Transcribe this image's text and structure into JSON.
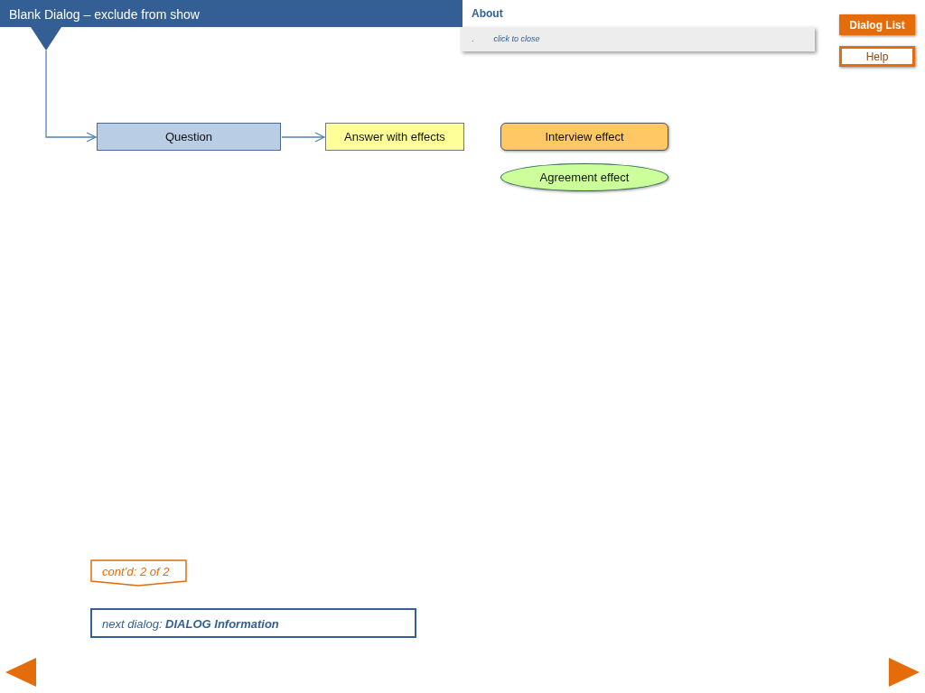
{
  "header": {
    "title": "Blank Dialog – exclude from show"
  },
  "about": {
    "title": "About",
    "bullet": ".",
    "hint": "click to close"
  },
  "buttons": [
    {
      "label": "Dialog List",
      "kind": "filled"
    },
    {
      "label": "Help",
      "kind": "outline"
    }
  ],
  "flow": {
    "nodes": [
      {
        "label": "Question",
        "kind": "question"
      },
      {
        "label": "Answer with effects",
        "kind": "answer"
      }
    ],
    "effects": [
      {
        "label": "Interview effect",
        "kind": "interview"
      },
      {
        "label": "Agreement effect",
        "kind": "agreement"
      }
    ]
  },
  "continued": "cont’d: 2 of 2",
  "next_dialog": "next dialog: **DIALOG Information**"
}
